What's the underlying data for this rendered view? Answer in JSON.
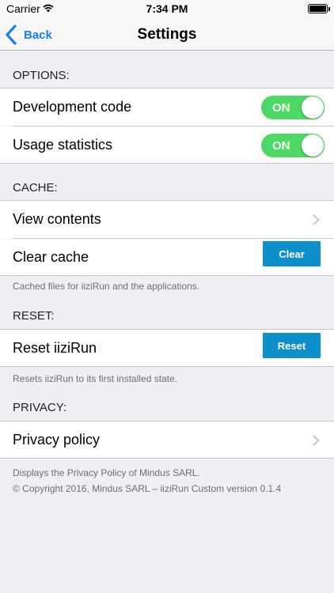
{
  "status_bar": {
    "carrier": "Carrier",
    "time": "7:34 PM",
    "wifi_icon": "wifi-icon",
    "battery_icon": "battery-icon",
    "battery_level": 1.0
  },
  "nav": {
    "back_label": "Back",
    "title": "Settings",
    "accent": "#157efb"
  },
  "sections": {
    "options": {
      "header": "OPTIONS:",
      "development_code": {
        "label": "Development code",
        "toggle": "ON",
        "enabled": true
      },
      "usage_statistics": {
        "label": "Usage statistics",
        "toggle": "ON",
        "enabled": true
      }
    },
    "cache": {
      "header": "CACHE:",
      "view_contents": {
        "label": "View contents"
      },
      "clear_cache": {
        "label": "Clear cache",
        "button": "Clear"
      },
      "footer": "Cached files for iiziRun and the applications."
    },
    "reset": {
      "header": "RESET:",
      "reset_iizirun": {
        "label": "Reset iiziRun",
        "button": "Reset"
      },
      "footer": "Resets iiziRun to its first installed state."
    },
    "privacy": {
      "header": "PRIVACY:",
      "privacy_policy": {
        "label": "Privacy policy"
      },
      "footer": "Displays the Privacy Policy of Mindus SARL.",
      "copyright": "© Copyright 2016, Mindus SARL – iiziRun Custom version 0.1.4"
    }
  },
  "colors": {
    "toggle_on": "#4cd964",
    "button": "#0d8fcb",
    "background": "#efeff4"
  }
}
